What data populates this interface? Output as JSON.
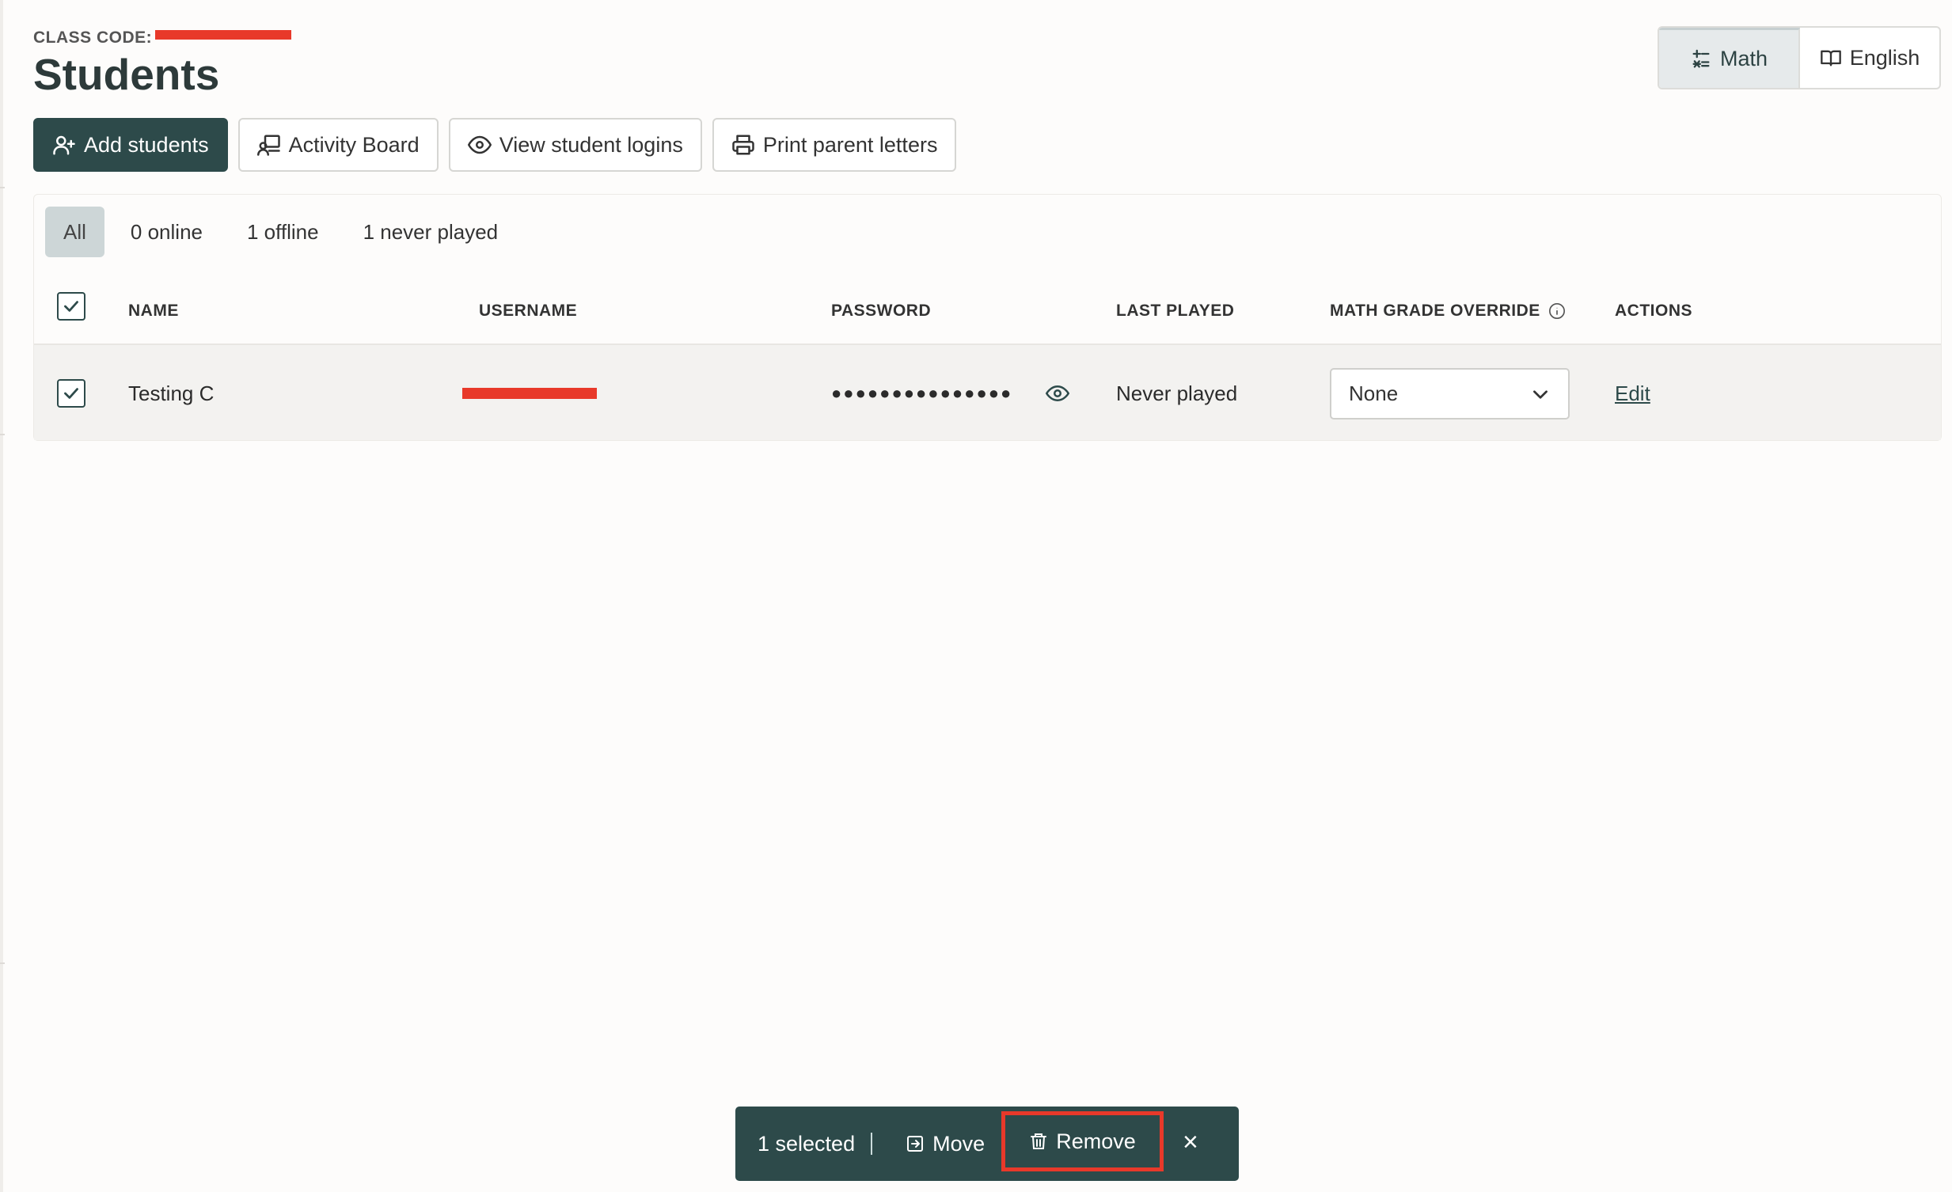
{
  "header": {
    "class_code_label": "CLASS CODE:",
    "title": "Students"
  },
  "subjects": [
    {
      "label": "Math",
      "icon": "math-icon",
      "active": true
    },
    {
      "label": "English",
      "icon": "book-icon",
      "active": false
    }
  ],
  "toolbar": {
    "add_students": "Add students",
    "activity_board": "Activity Board",
    "view_logins": "View student logins",
    "print_letters": "Print parent letters"
  },
  "filters": [
    "All",
    "0 online",
    "1 offline",
    "1 never played"
  ],
  "table": {
    "columns": [
      "NAME",
      "USERNAME",
      "PASSWORD",
      "LAST PLAYED",
      "MATH GRADE OVERRIDE",
      "ACTIONS"
    ],
    "rows": [
      {
        "name": "Testing C",
        "password": "●●●●●●●●●●●●●●●",
        "last_played": "Never played",
        "grade_override": "None",
        "action": "Edit"
      }
    ]
  },
  "bulk_bar": {
    "selected": "1 selected",
    "move": "Move",
    "remove": "Remove",
    "close": "×"
  },
  "colors": {
    "brand": "#2d4a4a",
    "highlight": "#e8392a",
    "filter_active": "#cdd6d7"
  }
}
